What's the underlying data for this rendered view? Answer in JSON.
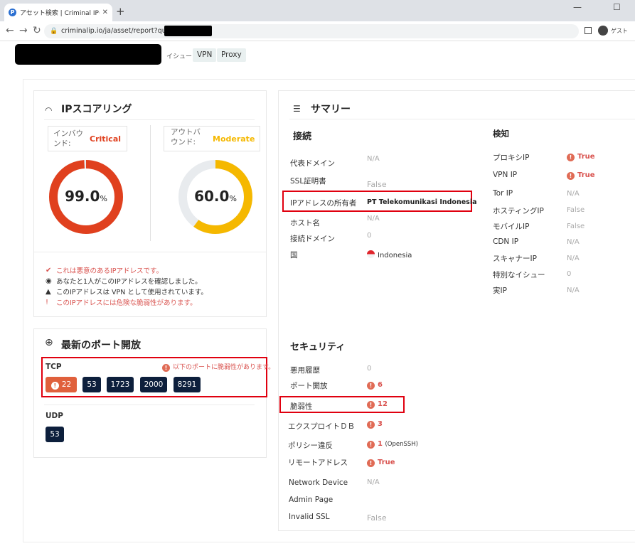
{
  "browser": {
    "tab_title": "アセット検索 | Criminal IP(クリミ",
    "url": "criminalip.io/ja/asset/report?query=",
    "guest_label": "ゲスト"
  },
  "header": {
    "issue_label": "イシュー:",
    "badges": [
      "VPN",
      "Proxy"
    ]
  },
  "score": {
    "title": "IPスコアリング",
    "inbound_label": "インバウンド:",
    "inbound_level": "Critical",
    "inbound_value": "99.0",
    "inbound_fraction": 0.99,
    "outbound_label": "アウトバウンド:",
    "outbound_level": "Moderate",
    "outbound_value": "60.0",
    "outbound_fraction": 0.6,
    "percent": "%",
    "notes": [
      {
        "icon": "✔",
        "text": "これは悪意のあるIPアドレスです。",
        "color": "#d9534f"
      },
      {
        "icon": "◉",
        "text": "あなたと1人がこのIPアドレスを確認しました。",
        "color": "#333"
      },
      {
        "icon": "▲",
        "text": "このIPアドレスは VPN として使用されています。",
        "color": "#333"
      },
      {
        "icon": "!",
        "text": "このIPアドレスには危険な脆弱性があります。",
        "color": "#d9534f"
      }
    ]
  },
  "ports": {
    "title": "最新のポート開放",
    "tcp_label": "TCP",
    "vuln_note": "以下のポートに脆弱性があります。",
    "tcp": [
      "22",
      "53",
      "1723",
      "2000",
      "8291"
    ],
    "udp_label": "UDP",
    "udp": [
      "53"
    ]
  },
  "summary": {
    "title": "サマリー",
    "connection_title": "接続",
    "connection": [
      {
        "label": "代表ドメイン",
        "value": "N/A"
      },
      {
        "label": "SSL証明書",
        "value": "False"
      },
      {
        "label": "IPアドレスの所有者",
        "value": "PT Telekomunikasi Indonesia"
      },
      {
        "label": "ホスト名",
        "value": "N/A"
      },
      {
        "label": "接続ドメイン",
        "value": "0"
      },
      {
        "label": "国",
        "value": "Indonesia"
      }
    ],
    "detection_title": "検知",
    "detection": [
      {
        "label": "プロキシIP",
        "value": "True"
      },
      {
        "label": "VPN IP",
        "value": "True"
      },
      {
        "label": "Tor IP",
        "value": "N/A"
      },
      {
        "label": "ホスティングIP",
        "value": "False"
      },
      {
        "label": "モバイルIP",
        "value": "False"
      },
      {
        "label": "CDN IP",
        "value": "N/A"
      },
      {
        "label": "スキャナーIP",
        "value": "N/A"
      },
      {
        "label": "特別なイシュー",
        "value": "0"
      },
      {
        "label": "実IP",
        "value": "N/A"
      }
    ],
    "security_title": "セキュリティ",
    "security": [
      {
        "label": "悪用履歴",
        "value": "0"
      },
      {
        "label": "ポート開放",
        "value": "6"
      },
      {
        "label": "脆弱性",
        "value": "12"
      },
      {
        "label": "エクスプロイトＤＢ",
        "value": "3"
      },
      {
        "label": "ポリシー違反",
        "value": "1",
        "extra": "(OpenSSH)"
      },
      {
        "label": "リモートアドレス",
        "value": "True"
      },
      {
        "label": "Network Device",
        "value": "N/A"
      },
      {
        "label": "Admin Page",
        "value": ""
      },
      {
        "label": "Invalid SSL",
        "value": "False"
      }
    ]
  },
  "colors": {
    "critical": "#e0401e",
    "moderate": "#f5b800",
    "navy": "#0d1f3c"
  }
}
